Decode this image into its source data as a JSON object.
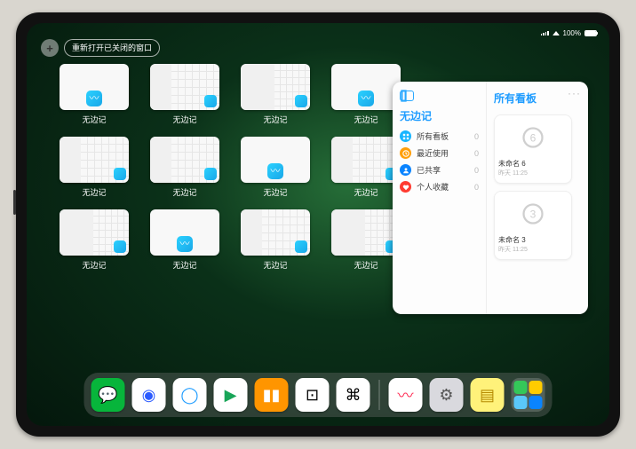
{
  "status": {
    "battery_pct": "100%"
  },
  "topbar": {
    "plus_label": "+",
    "reopen_label": "重新打开已关闭的窗口"
  },
  "thumbs": {
    "label": "无边记",
    "items": [
      {
        "variant": "blank"
      },
      {
        "variant": "cal"
      },
      {
        "variant": "cal2"
      },
      {
        "variant": "blank"
      },
      {
        "variant": "cal"
      },
      {
        "variant": "cal"
      },
      {
        "variant": "blank"
      },
      {
        "variant": "cal"
      },
      {
        "variant": "cal2"
      },
      {
        "variant": "blank"
      },
      {
        "variant": "cal"
      },
      {
        "variant": "cal2"
      }
    ]
  },
  "bigwin": {
    "left_title": "无边记",
    "right_title": "所有看板",
    "more": "···",
    "rows": [
      {
        "icon": "grid",
        "color": "#17b5ff",
        "label": "所有看板",
        "count": "0"
      },
      {
        "icon": "clock",
        "color": "#ff9f0a",
        "label": "最近使用",
        "count": "0"
      },
      {
        "icon": "people",
        "color": "#0a84ff",
        "label": "已共享",
        "count": "0"
      },
      {
        "icon": "heart",
        "color": "#ff3b30",
        "label": "个人收藏",
        "count": "0"
      }
    ],
    "boards": [
      {
        "title": "未命名 6",
        "sub": "昨天 11:25",
        "glyph": "6"
      },
      {
        "title": "未命名 3",
        "sub": "昨天 11:25",
        "glyph": "3"
      }
    ]
  },
  "dock": {
    "apps": [
      {
        "name": "wechat",
        "bg": "#07b53b",
        "glyph": "💬"
      },
      {
        "name": "browser-hd",
        "bg": "#ffffff",
        "glyph": "◉",
        "fg": "#2b5bff"
      },
      {
        "name": "browser-q",
        "bg": "#ffffff",
        "glyph": "◯",
        "fg": "#1e9cff"
      },
      {
        "name": "play",
        "bg": "#ffffff",
        "glyph": "▶",
        "fg": "#18a558"
      },
      {
        "name": "books",
        "bg": "#ff9500",
        "glyph": "▮▮",
        "fg": "#fff"
      },
      {
        "name": "dice",
        "bg": "#ffffff",
        "glyph": "⊡",
        "fg": "#000"
      },
      {
        "name": "nodes",
        "bg": "#ffffff",
        "glyph": "⌘",
        "fg": "#000"
      }
    ],
    "right": [
      {
        "name": "freeform",
        "bg": "#ffffff",
        "glyph": "〰",
        "fg": "#ff2d55"
      },
      {
        "name": "settings",
        "bg": "#d9d9de",
        "glyph": "⚙︎",
        "fg": "#555"
      },
      {
        "name": "notes",
        "bg": "#fff27a",
        "glyph": "▤",
        "fg": "#b58900"
      }
    ],
    "stack": [
      {
        "bg": "#34c759"
      },
      {
        "bg": "#ffcc00"
      },
      {
        "bg": "#5ac8fa"
      },
      {
        "bg": "#0a84ff"
      }
    ]
  }
}
